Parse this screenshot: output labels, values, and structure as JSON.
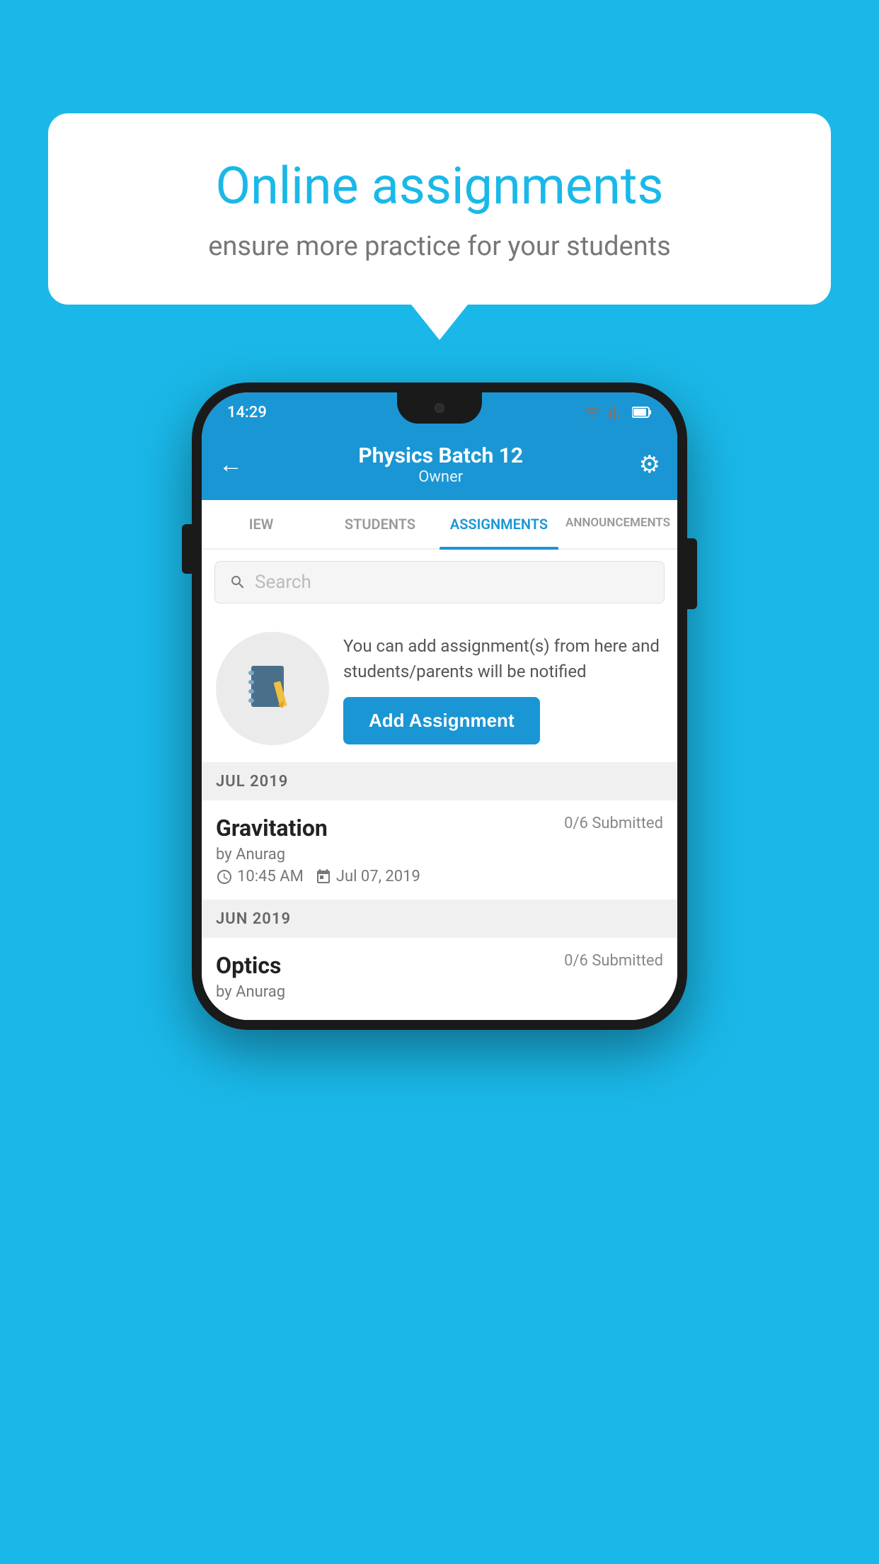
{
  "background_color": "#1ab8e8",
  "speech_bubble": {
    "title": "Online assignments",
    "subtitle": "ensure more practice for your students"
  },
  "status_bar": {
    "time": "14:29",
    "wifi_icon": "wifi",
    "signal_icon": "signal",
    "battery_icon": "battery"
  },
  "app_header": {
    "back_label": "←",
    "title": "Physics Batch 12",
    "subtitle": "Owner",
    "settings_label": "⚙"
  },
  "tabs": [
    {
      "label": "IEW",
      "active": false
    },
    {
      "label": "STUDENTS",
      "active": false
    },
    {
      "label": "ASSIGNMENTS",
      "active": true
    },
    {
      "label": "ANNOUNCEMENTS",
      "active": false
    }
  ],
  "search": {
    "placeholder": "Search"
  },
  "info_section": {
    "description": "You can add assignment(s) from here and students/parents will be notified",
    "button_label": "Add Assignment"
  },
  "sections": [
    {
      "header": "JUL 2019",
      "assignments": [
        {
          "name": "Gravitation",
          "submitted": "0/6 Submitted",
          "by": "by Anurag",
          "time": "10:45 AM",
          "date": "Jul 07, 2019"
        }
      ]
    },
    {
      "header": "JUN 2019",
      "assignments": [
        {
          "name": "Optics",
          "submitted": "0/6 Submitted",
          "by": "by Anurag",
          "time": "",
          "date": ""
        }
      ]
    }
  ]
}
